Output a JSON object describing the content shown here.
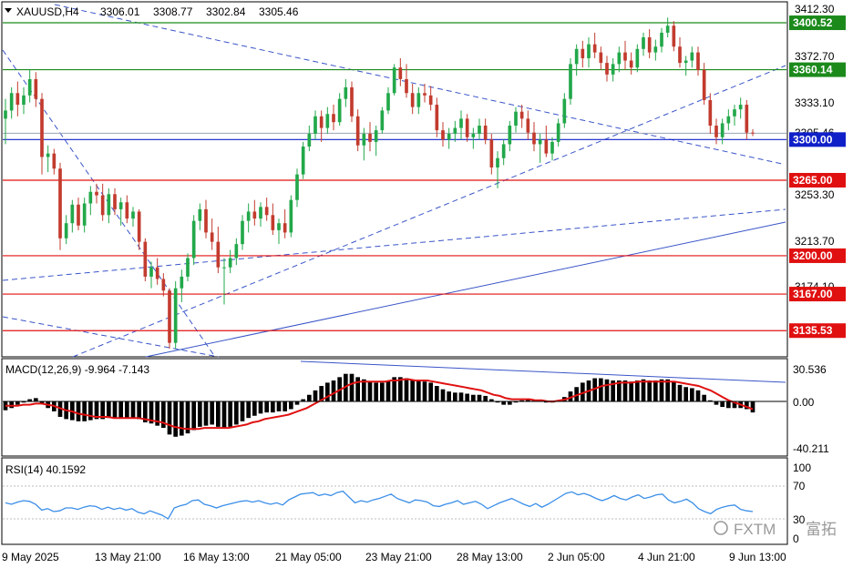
{
  "header": {
    "symbol": "XAUUSD,H4",
    "open": "3306.01",
    "high": "3308.77",
    "low": "3302.84",
    "close": "3305.46"
  },
  "colors": {
    "bull": "#22a84a",
    "bear": "#c23b2e",
    "grid": "#cfcfcf",
    "support_line": "#e01010",
    "resistance_line": "#1b8a1b",
    "pivot_line": "#1020c8",
    "trend_dashed": "#3a55c8",
    "macd_hist": "#000000",
    "macd_signal": "#e01010",
    "rsi_line": "#3a8ee8"
  },
  "price_axis": {
    "ticks": [
      "3412.30",
      "3372.70",
      "3333.10",
      "3253.30",
      "3213.70",
      "3174.10"
    ]
  },
  "price_tags": [
    {
      "value": "3400.52",
      "color": "#1b8a1b"
    },
    {
      "value": "3360.14",
      "color": "#1b8a1b"
    },
    {
      "value": "3300.00",
      "color": "#1020c8"
    },
    {
      "value": "3265.00",
      "color": "#e01010"
    },
    {
      "value": "3200.00",
      "color": "#e01010"
    },
    {
      "value": "3167.00",
      "color": "#e01010"
    },
    {
      "value": "3135.53",
      "color": "#e01010"
    }
  ],
  "current_price": "3305.46",
  "macd": {
    "label": "MACD(12,26,9) -9.964 -7.143",
    "ticks": [
      "30.536",
      "0.00",
      "-40.211"
    ]
  },
  "rsi": {
    "label": "RSI(14) 40.1592",
    "ticks": [
      "100",
      "70",
      "30",
      "0"
    ]
  },
  "time_axis": {
    "labels": [
      "9 May 2025",
      "13 May 21:00",
      "16 May 13:00",
      "21 May 05:00",
      "23 May 21:00",
      "28 May 13:00",
      "2 Jun 05:00",
      "4 Jun 21:00",
      "9 Jun 13:00"
    ]
  },
  "watermark": {
    "brand": "FXTM",
    "cn": "富拓"
  },
  "chart_data": {
    "type": "candlestick",
    "symbol": "XAUUSD",
    "timeframe": "H4",
    "y_range": [
      3115,
      3420
    ],
    "horizontal_levels": {
      "resistance": [
        3400.52,
        3360.14
      ],
      "pivot": [
        3300.0
      ],
      "support": [
        3265.0,
        3200.0,
        3167.0,
        3135.53
      ]
    },
    "ohlc": [
      [
        3318,
        3335,
        3296,
        3325
      ],
      [
        3325,
        3345,
        3318,
        3340
      ],
      [
        3340,
        3350,
        3320,
        3330
      ],
      [
        3330,
        3345,
        3322,
        3338
      ],
      [
        3338,
        3360,
        3332,
        3352
      ],
      [
        3352,
        3358,
        3328,
        3335
      ],
      [
        3335,
        3340,
        3270,
        3285
      ],
      [
        3285,
        3295,
        3272,
        3288
      ],
      [
        3288,
        3292,
        3270,
        3275
      ],
      [
        3275,
        3280,
        3205,
        3215
      ],
      [
        3215,
        3235,
        3210,
        3228
      ],
      [
        3228,
        3248,
        3220,
        3244
      ],
      [
        3244,
        3250,
        3222,
        3226
      ],
      [
        3226,
        3250,
        3220,
        3245
      ],
      [
        3245,
        3260,
        3235,
        3255
      ],
      [
        3255,
        3262,
        3245,
        3252
      ],
      [
        3252,
        3262,
        3230,
        3235
      ],
      [
        3235,
        3258,
        3228,
        3253
      ],
      [
        3253,
        3258,
        3235,
        3240
      ],
      [
        3240,
        3250,
        3226,
        3246
      ],
      [
        3246,
        3252,
        3228,
        3232
      ],
      [
        3232,
        3242,
        3225,
        3238
      ],
      [
        3238,
        3240,
        3205,
        3212
      ],
      [
        3212,
        3215,
        3178,
        3182
      ],
      [
        3182,
        3195,
        3172,
        3190
      ],
      [
        3190,
        3198,
        3175,
        3180
      ],
      [
        3180,
        3185,
        3165,
        3170
      ],
      [
        3170,
        3172,
        3120,
        3125
      ],
      [
        3125,
        3178,
        3120,
        3172
      ],
      [
        3172,
        3188,
        3160,
        3182
      ],
      [
        3182,
        3202,
        3178,
        3198
      ],
      [
        3198,
        3235,
        3192,
        3230
      ],
      [
        3230,
        3245,
        3222,
        3240
      ],
      [
        3240,
        3248,
        3215,
        3220
      ],
      [
        3220,
        3232,
        3205,
        3212
      ],
      [
        3212,
        3225,
        3185,
        3190
      ],
      [
        3190,
        3198,
        3158,
        3190
      ],
      [
        3190,
        3205,
        3185,
        3198
      ],
      [
        3198,
        3215,
        3192,
        3210
      ],
      [
        3210,
        3235,
        3205,
        3230
      ],
      [
        3230,
        3245,
        3220,
        3238
      ],
      [
        3238,
        3248,
        3226,
        3232
      ],
      [
        3232,
        3246,
        3225,
        3242
      ],
      [
        3242,
        3250,
        3230,
        3235
      ],
      [
        3235,
        3245,
        3218,
        3222
      ],
      [
        3222,
        3232,
        3210,
        3228
      ],
      [
        3228,
        3240,
        3215,
        3220
      ],
      [
        3220,
        3252,
        3216,
        3248
      ],
      [
        3248,
        3275,
        3242,
        3270
      ],
      [
        3270,
        3298,
        3266,
        3294
      ],
      [
        3294,
        3312,
        3290,
        3305
      ],
      [
        3305,
        3325,
        3300,
        3320
      ],
      [
        3320,
        3325,
        3298,
        3310
      ],
      [
        3310,
        3328,
        3305,
        3322
      ],
      [
        3322,
        3330,
        3308,
        3315
      ],
      [
        3315,
        3340,
        3312,
        3335
      ],
      [
        3335,
        3352,
        3328,
        3345
      ],
      [
        3345,
        3350,
        3315,
        3320
      ],
      [
        3320,
        3326,
        3290,
        3295
      ],
      [
        3295,
        3310,
        3282,
        3305
      ],
      [
        3305,
        3315,
        3290,
        3298
      ],
      [
        3298,
        3312,
        3286,
        3308
      ],
      [
        3308,
        3328,
        3305,
        3325
      ],
      [
        3325,
        3345,
        3322,
        3340
      ],
      [
        3340,
        3365,
        3338,
        3362
      ],
      [
        3362,
        3370,
        3346,
        3352
      ],
      [
        3352,
        3365,
        3336,
        3340
      ],
      [
        3340,
        3348,
        3322,
        3328
      ],
      [
        3328,
        3345,
        3322,
        3340
      ],
      [
        3340,
        3348,
        3332,
        3338
      ],
      [
        3338,
        3346,
        3325,
        3330
      ],
      [
        3330,
        3336,
        3302,
        3308
      ],
      [
        3308,
        3315,
        3294,
        3300
      ],
      [
        3300,
        3310,
        3292,
        3305
      ],
      [
        3305,
        3316,
        3298,
        3310
      ],
      [
        3310,
        3325,
        3300,
        3318
      ],
      [
        3318,
        3322,
        3298,
        3302
      ],
      [
        3302,
        3310,
        3292,
        3305
      ],
      [
        3305,
        3318,
        3300,
        3312
      ],
      [
        3312,
        3318,
        3296,
        3300
      ],
      [
        3300,
        3305,
        3270,
        3276
      ],
      [
        3276,
        3290,
        3258,
        3284
      ],
      [
        3284,
        3300,
        3278,
        3296
      ],
      [
        3296,
        3316,
        3290,
        3312
      ],
      [
        3312,
        3328,
        3306,
        3324
      ],
      [
        3324,
        3330,
        3310,
        3318
      ],
      [
        3318,
        3325,
        3300,
        3306
      ],
      [
        3306,
        3315,
        3290,
        3296
      ],
      [
        3296,
        3305,
        3280,
        3300
      ],
      [
        3300,
        3312,
        3285,
        3288
      ],
      [
        3288,
        3302,
        3282,
        3298
      ],
      [
        3298,
        3318,
        3294,
        3314
      ],
      [
        3314,
        3340,
        3310,
        3335
      ],
      [
        3335,
        3370,
        3330,
        3365
      ],
      [
        3365,
        3382,
        3355,
        3378
      ],
      [
        3378,
        3385,
        3362,
        3370
      ],
      [
        3370,
        3388,
        3362,
        3382
      ],
      [
        3382,
        3392,
        3370,
        3375
      ],
      [
        3375,
        3380,
        3360,
        3366
      ],
      [
        3366,
        3372,
        3350,
        3356
      ],
      [
        3356,
        3370,
        3350,
        3365
      ],
      [
        3365,
        3380,
        3358,
        3375
      ],
      [
        3375,
        3385,
        3360,
        3368
      ],
      [
        3368,
        3375,
        3356,
        3362
      ],
      [
        3362,
        3382,
        3358,
        3378
      ],
      [
        3378,
        3392,
        3372,
        3388
      ],
      [
        3388,
        3395,
        3370,
        3375
      ],
      [
        3375,
        3386,
        3368,
        3380
      ],
      [
        3380,
        3396,
        3375,
        3392
      ],
      [
        3392,
        3405,
        3388,
        3398
      ],
      [
        3398,
        3402,
        3376,
        3380
      ],
      [
        3380,
        3388,
        3362,
        3366
      ],
      [
        3366,
        3372,
        3355,
        3368
      ],
      [
        3368,
        3380,
        3362,
        3375
      ],
      [
        3375,
        3380,
        3355,
        3360
      ],
      [
        3360,
        3366,
        3330,
        3334
      ],
      [
        3334,
        3340,
        3305,
        3312
      ],
      [
        3312,
        3318,
        3296,
        3302
      ],
      [
        3302,
        3318,
        3296,
        3314
      ],
      [
        3314,
        3326,
        3308,
        3320
      ],
      [
        3320,
        3330,
        3312,
        3326
      ],
      [
        3326,
        3336,
        3318,
        3330
      ],
      [
        3330,
        3334,
        3300,
        3306
      ],
      [
        3306,
        3309,
        3303,
        3305.46
      ]
    ],
    "macd": {
      "name": "MACD(12,26,9)",
      "main": -9.964,
      "signal": -7.143,
      "hist": [
        -8,
        -6,
        -3,
        -1,
        2,
        3,
        -2,
        -6,
        -9,
        -14,
        -16,
        -17,
        -18,
        -18,
        -17,
        -16,
        -16,
        -15,
        -15,
        -15,
        -15,
        -15,
        -16,
        -19,
        -20,
        -22,
        -24,
        -30,
        -32,
        -31,
        -29,
        -26,
        -23,
        -22,
        -21,
        -23,
        -24,
        -23,
        -21,
        -18,
        -15,
        -13,
        -11,
        -10,
        -10,
        -9,
        -9,
        -7,
        -3,
        2,
        6,
        10,
        14,
        17,
        19,
        22,
        25,
        25,
        22,
        20,
        18,
        17,
        17,
        19,
        22,
        22,
        21,
        19,
        19,
        18,
        17,
        14,
        11,
        9,
        8,
        8,
        7,
        6,
        6,
        5,
        2,
        -1,
        -3,
        -3,
        -1,
        1,
        2,
        1,
        0,
        -1,
        -1,
        1,
        4,
        9,
        13,
        17,
        19,
        21,
        21,
        20,
        19,
        19,
        19,
        18,
        19,
        20,
        19,
        19,
        20,
        20,
        18,
        15,
        13,
        12,
        10,
        6,
        1,
        -3,
        -5,
        -6,
        -6,
        -6,
        -7,
        -10
      ],
      "signal_line": [
        -4,
        -4,
        -4,
        -3,
        -3,
        -2,
        -2,
        -3,
        -4,
        -6,
        -8,
        -9,
        -11,
        -12,
        -13,
        -14,
        -14,
        -14,
        -15,
        -15,
        -15,
        -15,
        -15,
        -16,
        -17,
        -18,
        -19,
        -21,
        -23,
        -24,
        -25,
        -25,
        -25,
        -24,
        -24,
        -24,
        -24,
        -24,
        -23,
        -22,
        -21,
        -19,
        -18,
        -16,
        -15,
        -14,
        -13,
        -12,
        -10,
        -8,
        -6,
        -3,
        0,
        3,
        6,
        9,
        12,
        15,
        17,
        18,
        18,
        18,
        18,
        18,
        19,
        19,
        20,
        20,
        19,
        19,
        19,
        18,
        17,
        16,
        15,
        14,
        13,
        12,
        11,
        10,
        8,
        6,
        5,
        3,
        2,
        2,
        2,
        2,
        1,
        1,
        0,
        0,
        1,
        2,
        4,
        6,
        8,
        10,
        12,
        14,
        15,
        16,
        17,
        17,
        17,
        18,
        18,
        18,
        18,
        18,
        18,
        18,
        17,
        16,
        15,
        14,
        12,
        10,
        7,
        4,
        1,
        -1,
        -3,
        -5,
        -7
      ]
    },
    "rsi": {
      "name": "RSI(14)",
      "current": 40.1592,
      "levels": [
        70,
        30
      ],
      "values": [
        52,
        50,
        53,
        55,
        54,
        50,
        42,
        44,
        40,
        41,
        45,
        45,
        43,
        46,
        48,
        47,
        43,
        46,
        43,
        45,
        42,
        44,
        39,
        37,
        41,
        38,
        35,
        30,
        45,
        48,
        50,
        55,
        56,
        50,
        48,
        45,
        48,
        50,
        52,
        54,
        55,
        53,
        55,
        52,
        50,
        52,
        49,
        56,
        60,
        64,
        65,
        66,
        62,
        64,
        62,
        66,
        68,
        60,
        52,
        55,
        53,
        56,
        58,
        61,
        64,
        58,
        55,
        52,
        56,
        55,
        53,
        48,
        47,
        50,
        52,
        55,
        50,
        52,
        54,
        50,
        44,
        48,
        52,
        55,
        58,
        54,
        50,
        47,
        51,
        46,
        50,
        55,
        60,
        65,
        67,
        63,
        65,
        62,
        58,
        55,
        58,
        62,
        58,
        56,
        60,
        63,
        58,
        60,
        63,
        64,
        56,
        52,
        54,
        57,
        52,
        44,
        40,
        37,
        43,
        46,
        48,
        49,
        43,
        41,
        40
      ]
    }
  }
}
